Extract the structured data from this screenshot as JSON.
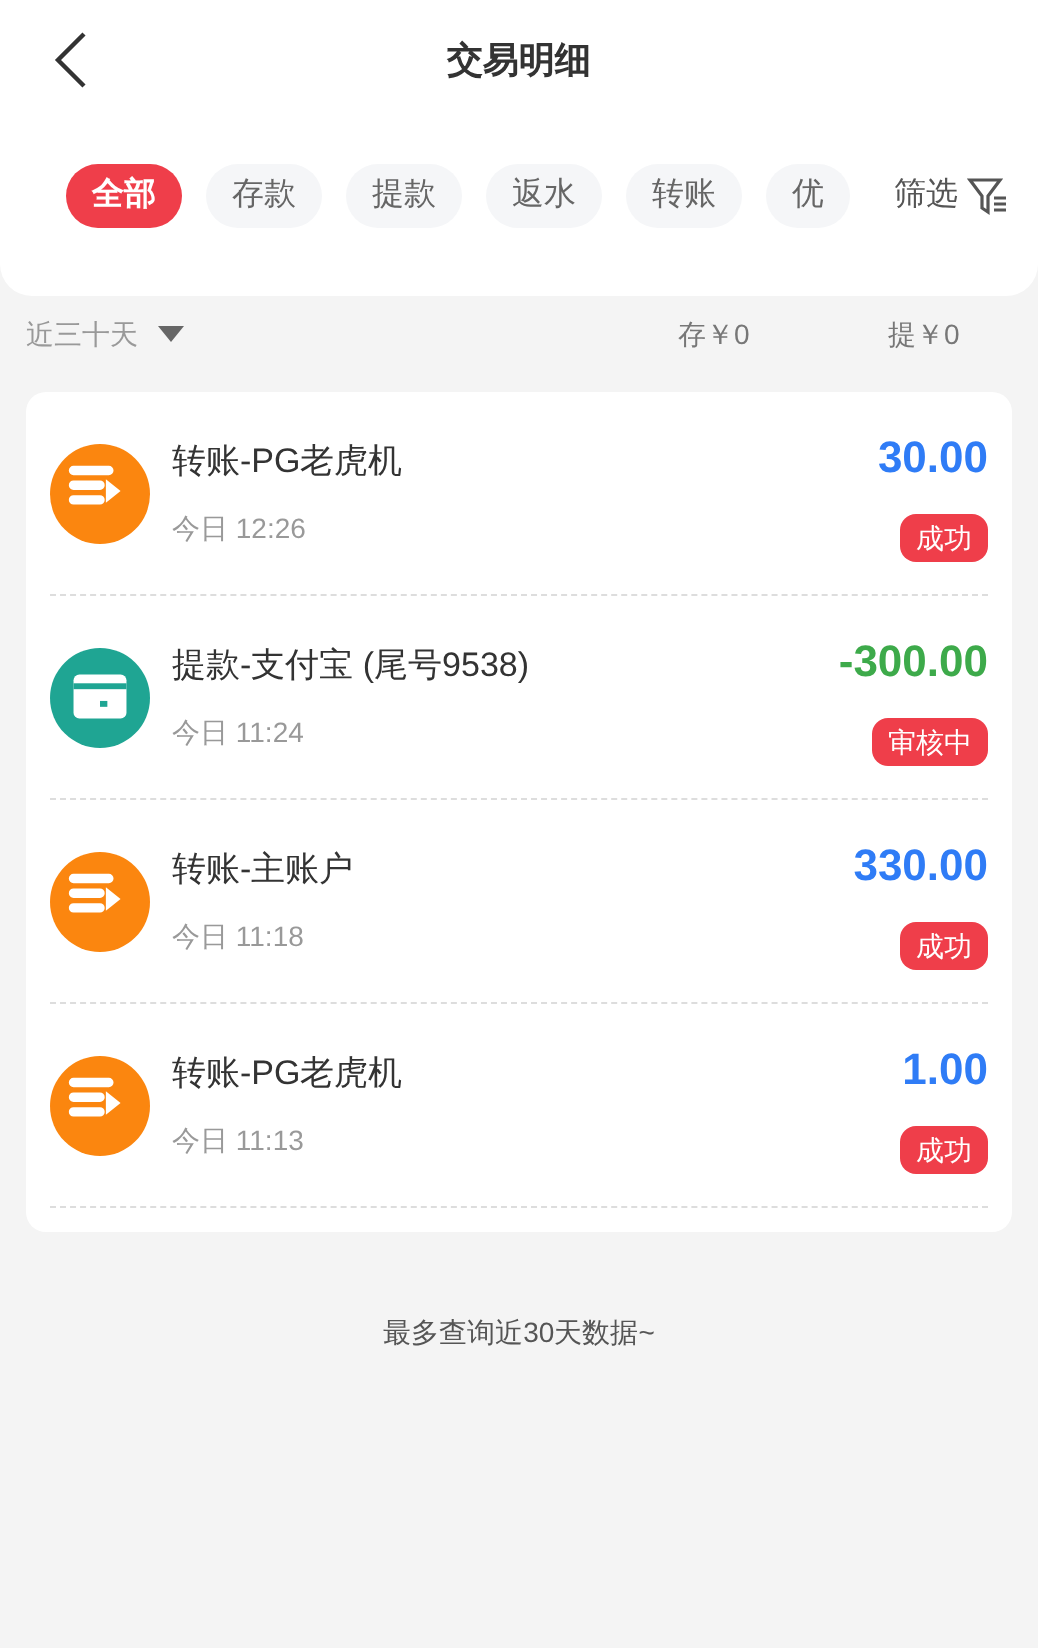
{
  "header": {
    "title": "交易明细"
  },
  "tabs": [
    {
      "label": "全部",
      "selected": true
    },
    {
      "label": "存款",
      "selected": false
    },
    {
      "label": "提款",
      "selected": false
    },
    {
      "label": "返水",
      "selected": false
    },
    {
      "label": "转账",
      "selected": false
    },
    {
      "label": "优",
      "selected": false
    }
  ],
  "filter": {
    "label": "筛选"
  },
  "summary": {
    "period": "近三十天",
    "deposit": "存￥0",
    "withdraw": "提￥0"
  },
  "transactions": [
    {
      "kind": "transfer",
      "title": "转账-PG老虎机",
      "time": "今日 12:26",
      "amount": "30.00",
      "status": "成功"
    },
    {
      "kind": "withdrawal",
      "title": "提款-支付宝 (尾号9538)",
      "time": "今日 11:24",
      "amount": "-300.00",
      "status": "审核中"
    },
    {
      "kind": "transfer",
      "title": "转账-主账户",
      "time": "今日 11:18",
      "amount": "330.00",
      "status": "成功"
    },
    {
      "kind": "transfer",
      "title": "转账-PG老虎机",
      "time": "今日 11:13",
      "amount": "1.00",
      "status": "成功"
    }
  ],
  "footer": "最多查询近30天数据~"
}
